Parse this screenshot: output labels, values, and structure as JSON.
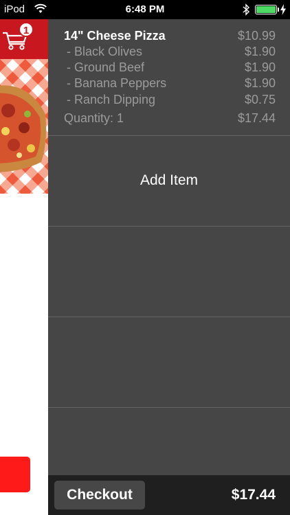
{
  "status_bar": {
    "carrier": "iPod",
    "time": "6:48 PM",
    "battery_level": 1.0
  },
  "left_app": {
    "cart_count": "1",
    "colors": {
      "header": "#c8171e",
      "button": "#ff1a1a"
    }
  },
  "cart": {
    "item": {
      "name": "14\" Cheese Pizza",
      "price": "$10.99",
      "options": [
        {
          "label": "- Black Olives",
          "price": "$1.90"
        },
        {
          "label": "- Ground Beef",
          "price": "$1.90"
        },
        {
          "label": "- Banana Peppers",
          "price": "$1.90"
        },
        {
          "label": "- Ranch Dipping",
          "price": "$0.75"
        }
      ],
      "quantity_label": "Quantity: 1",
      "line_total": "$17.44"
    },
    "add_item_label": "Add Item"
  },
  "footer": {
    "checkout_label": "Checkout",
    "total": "$17.44"
  }
}
